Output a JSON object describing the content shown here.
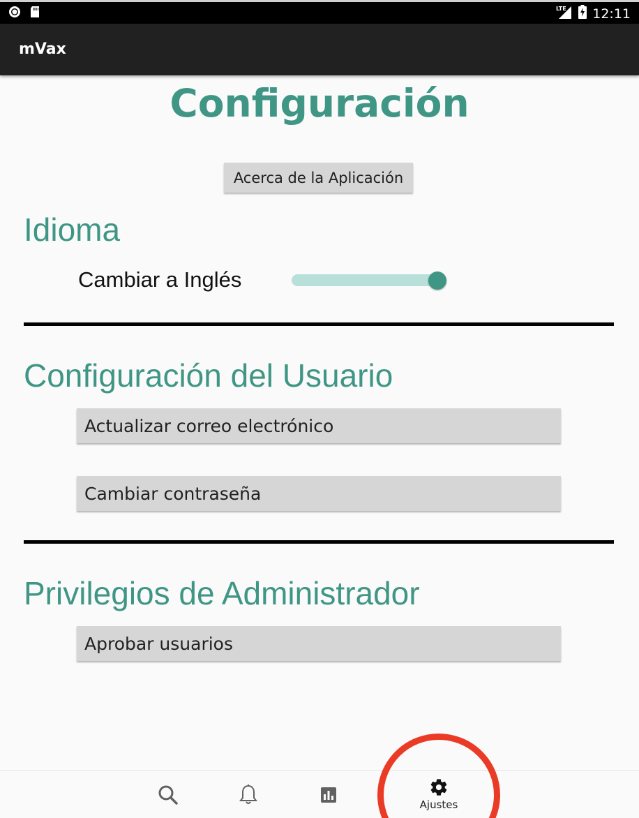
{
  "status_bar": {
    "time": "12:11",
    "network": "LTE",
    "icons": [
      "record-icon",
      "sd-card-icon",
      "signal-icon",
      "battery-charging-icon"
    ]
  },
  "app_bar": {
    "title": "mVax"
  },
  "page": {
    "title": "Configuración",
    "about_button": "Acerca de la Aplicación"
  },
  "language": {
    "heading": "Idioma",
    "toggle_label": "Cambiar a Inglés",
    "toggle_on": true
  },
  "user_settings": {
    "heading": "Configuración del Usuario",
    "update_email_button": "Actualizar correo electrónico",
    "change_password_button": "Cambiar contraseña"
  },
  "admin": {
    "heading": "Privilegios de Administrador",
    "approve_users_button": "Aprobar usuarios"
  },
  "bottom_nav": {
    "items": [
      {
        "icon": "search-icon",
        "label": ""
      },
      {
        "icon": "bell-icon",
        "label": ""
      },
      {
        "icon": "chart-icon",
        "label": ""
      },
      {
        "icon": "gear-icon",
        "label": "Ajustes",
        "selected": true
      }
    ]
  },
  "colors": {
    "accent": "#3f9685",
    "switch_track": "#b8dfda",
    "app_bar": "#212121",
    "button": "#d6d6d6",
    "highlight": "#ea3b26"
  }
}
